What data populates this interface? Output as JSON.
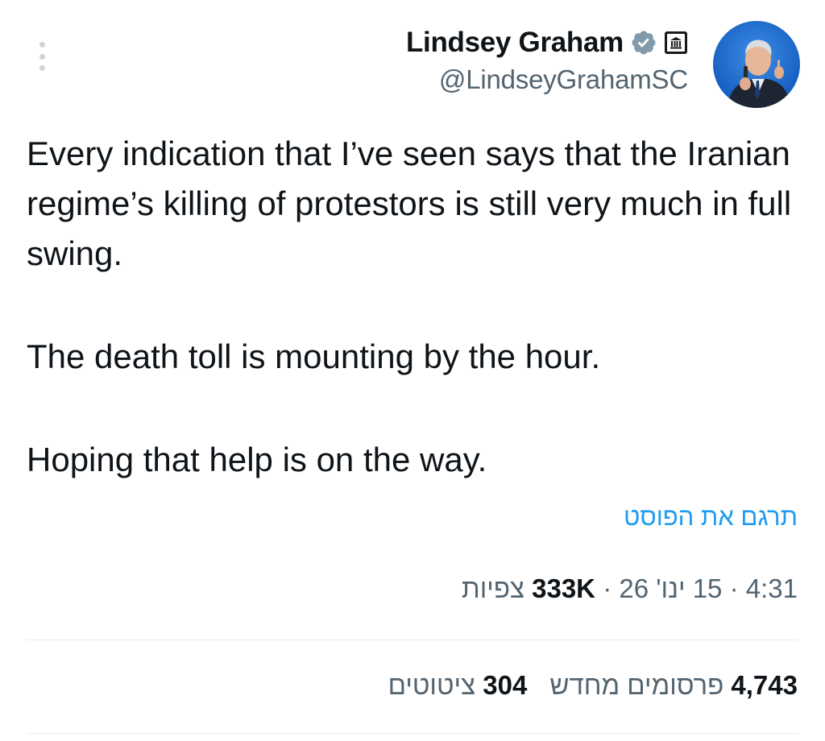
{
  "author": {
    "display_name": "Lindsey Graham",
    "handle": "@LindseyGrahamSC",
    "verified_icon": "verified-badge-icon",
    "affiliation_icon": "government-building-icon"
  },
  "tweet": {
    "paragraphs": [
      "Every indication that I’ve seen says that the Iranian regime’s killing of protestors is still very much in full swing.",
      "The death toll is mounting by the hour.",
      "Hoping that help is on the way."
    ],
    "translate_label": "תרגם את הפוסט"
  },
  "meta": {
    "time": "4:31",
    "date": "15 ינו' 26",
    "views_count": "333K",
    "views_label": "צפיות",
    "separator": "·"
  },
  "stats": {
    "reposts_count": "4,743",
    "reposts_label": "פרסומים מחדש",
    "quotes_count": "304",
    "quotes_label": "ציטוטים"
  },
  "colors": {
    "link": "#1d9bf0",
    "secondary_text": "#536471",
    "primary_text": "#0f1419",
    "verified_grey": "#829aab",
    "divider": "#e7ebee"
  }
}
